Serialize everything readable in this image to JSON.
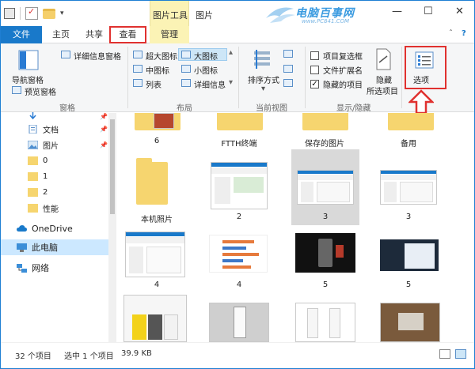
{
  "titlebar": {
    "tools_label": "图片工具",
    "window_title": "图片",
    "watermark_text": "电脑百事网",
    "watermark_url": "www.PC841.COM",
    "minimize": "—",
    "maximize": "☐",
    "close": "✕"
  },
  "tabs": {
    "file": "文件",
    "home": "主页",
    "share": "共享",
    "view": "查看",
    "manage": "管理",
    "collapse": "ˆ",
    "help": "?"
  },
  "ribbon": {
    "panes": {
      "nav_pane": "导航窗格",
      "preview_pane": "预览窗格",
      "details_pane": "详细信息窗格",
      "label": "窗格"
    },
    "layout": {
      "xl_icons": "超大图标",
      "large_icons": "大图标",
      "medium_icons": "中图标",
      "small_icons": "小图标",
      "list": "列表",
      "details": "详细信息",
      "label": "布局"
    },
    "current_view": {
      "sort_by": "排序方式",
      "label": "当前视图"
    },
    "show_hide": {
      "item_checkboxes": "项目复选框",
      "file_extensions": "文件扩展名",
      "hidden_items": "隐藏的项目",
      "hide_selected_1": "隐藏",
      "hide_selected_2": "所选项目",
      "label": "显示/隐藏",
      "hidden_items_checked": true
    },
    "options": "选项"
  },
  "nav": {
    "items": [
      {
        "label": "",
        "icon": "download-icon"
      },
      {
        "label": "文档",
        "icon": "documents-icon"
      },
      {
        "label": "图片",
        "icon": "pictures-icon"
      },
      {
        "label": "0",
        "icon": "folder-icon"
      },
      {
        "label": "1",
        "icon": "folder-icon"
      },
      {
        "label": "2",
        "icon": "folder-icon"
      },
      {
        "label": "性能",
        "icon": "folder-icon"
      },
      {
        "label": "OneDrive",
        "icon": "cloud-icon"
      },
      {
        "label": "此电脑",
        "icon": "computer-icon"
      },
      {
        "label": "网络",
        "icon": "network-icon"
      }
    ]
  },
  "content": {
    "row0": [
      "6",
      "FTTH终端",
      "保存的图片",
      "备用"
    ],
    "row1": [
      "本机照片",
      "2",
      "3",
      "3"
    ],
    "row2": [
      "4",
      "4",
      "5",
      "5"
    ]
  },
  "status": {
    "item_count": "32 个项目",
    "selection": "选中 1 个项目",
    "size": "39.9 KB"
  },
  "colors": {
    "accent": "#1979ca",
    "highlight_red": "#e0312f",
    "tools_yellow": "#fbf3b5",
    "folder": "#f6d56f"
  }
}
